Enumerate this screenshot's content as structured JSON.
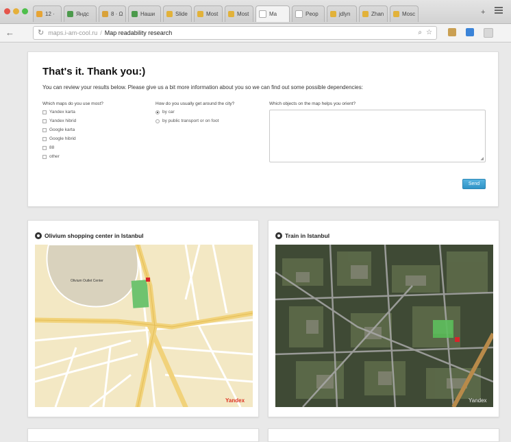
{
  "browser": {
    "tabs": [
      {
        "label": "12 ·",
        "favicon_color": "#e7a434"
      },
      {
        "label": "Яндс",
        "favicon_color": "#4c9a4c"
      },
      {
        "label": "8 · Ω",
        "favicon_color": "#d9a23a"
      },
      {
        "label": "Наши",
        "favicon_color": "#4c9a4c"
      },
      {
        "label": "Slide",
        "favicon_color": "#e2b23a"
      },
      {
        "label": "Most",
        "favicon_color": "#e2b23a"
      },
      {
        "label": "Most",
        "favicon_color": "#e2b23a"
      },
      {
        "label": "Ma",
        "favicon_color": "#cfcfcf"
      },
      {
        "label": "Peop",
        "favicon_color": "#cfcfcf"
      },
      {
        "label": "jdlyn",
        "favicon_color": "#e2b23a"
      },
      {
        "label": "Zhan",
        "favicon_color": "#e2b23a"
      },
      {
        "label": "Mosc",
        "favicon_color": "#e2b23a"
      }
    ],
    "new_tab_label": "+",
    "address_host": "maps.i-am-cool.ru",
    "address_sep": "/",
    "address_title": "Map readability research",
    "back_label": "←",
    "reload_label": "↻"
  },
  "form": {
    "heading": "That's it. Thank you:)",
    "intro": "You can review your results below. Please give us a bit more information about you so we can find out some possible dependencies:",
    "maps_question": "Which maps do you use most?",
    "maps_options": [
      "Yandex karta",
      "Yandex hibrid",
      "Google karta",
      "Google hibrid",
      "88",
      "other"
    ],
    "transport_question": "How do you usually get around the city?",
    "transport_options": [
      "by car",
      "by public transport or on foot"
    ],
    "objects_question": "Which objects on the map helps you orient?",
    "send_label": "Send"
  },
  "maps": {
    "left_title": "Olivium shopping center in Istanbul",
    "left_place_label": "Olivium Outlet Center",
    "left_logo": "Yandex",
    "right_title": "Train in Istanbul",
    "right_logo": "Yandex"
  },
  "colors": {
    "accent": "#2f93c6",
    "map_bg": "#f3e8c4",
    "road": "#f1d27a",
    "marker": "#d8242b",
    "park": "#6fc36f"
  }
}
